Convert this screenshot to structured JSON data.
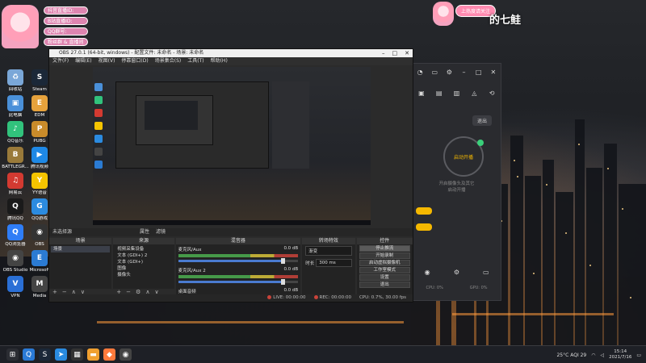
{
  "stickers": {
    "chat_lines": [
      "抖音直播ID:",
      "B站直播ID:",
      "QQ群号:",
      "粉丝群 & 直播间"
    ],
    "badge": "上热度请关注",
    "streamer_name": "的七鲑"
  },
  "desktop": {
    "icons_left": [
      {
        "label": "回收站",
        "color": "#7aa7d8",
        "glyph": "♻"
      },
      {
        "label": "Steam",
        "color": "#1b2838",
        "glyph": "S"
      },
      {
        "label": "此电脑",
        "color": "#4a90d9",
        "glyph": "▣"
      },
      {
        "label": "EDM",
        "color": "#e6a23c",
        "glyph": "E"
      },
      {
        "label": "QQ音乐",
        "color": "#31c27c",
        "glyph": "♪"
      },
      {
        "label": "PUBG",
        "color": "#c98b2a",
        "glyph": "P"
      },
      {
        "label": "BATTLEGR...",
        "color": "#9a7a3a",
        "glyph": "B"
      },
      {
        "label": "腾讯视频",
        "color": "#1e88e5",
        "glyph": "▶"
      },
      {
        "label": "网易云",
        "color": "#d33a31",
        "glyph": "♫"
      },
      {
        "label": "YY语音",
        "color": "#f5c400",
        "glyph": "Y"
      },
      {
        "label": "腾讯QQ",
        "color": "#1a1a1a",
        "glyph": "Q"
      },
      {
        "label": "QQ游戏",
        "color": "#2b8be0",
        "glyph": "G"
      },
      {
        "label": "QQ浏览器",
        "color": "#2f7df6",
        "glyph": "Q"
      },
      {
        "label": "OBS",
        "color": "#333",
        "glyph": "◉"
      },
      {
        "label": "OBS Studio",
        "color": "#444",
        "glyph": "◉"
      },
      {
        "label": "Microsoft",
        "color": "#2b7bd3",
        "glyph": "E"
      },
      {
        "label": "VPN",
        "color": "#2a6fd6",
        "glyph": "V"
      },
      {
        "label": "Media",
        "color": "#444",
        "glyph": "M"
      }
    ]
  },
  "obs": {
    "title": "OBS 27.0.1 (64-bit, windows) - 配置文件: 未命名 - 场景: 未命名",
    "menu": [
      "文件(F)",
      "编辑(E)",
      "视图(V)",
      "停靠窗口(D)",
      "场景集合(S)",
      "工具(T)",
      "帮助(H)"
    ],
    "scene_bar_text": "未选择源",
    "props_label": "属性",
    "filters_label": "滤镜",
    "docks": {
      "scenes": {
        "title": "场景",
        "items": [
          "场景"
        ]
      },
      "sources": {
        "title": "来源",
        "items": [
          "视频采集设备",
          "文本 (GDI+) 2",
          "文本 (GDI+)",
          "图像",
          "摄像头"
        ]
      },
      "mixer": {
        "title": "混音器",
        "rows": [
          {
            "name": "麦克风/Aux",
            "db": "0.0 dB"
          },
          {
            "name": "麦克风/Aux 2",
            "db": "0.0 dB"
          },
          {
            "name": "桌面音频",
            "db": "0.0 dB"
          }
        ]
      },
      "transitions": {
        "title": "转场特效",
        "type": "渐变",
        "duration_label": "时长",
        "duration": "300 ms"
      },
      "controls": {
        "title": "控件",
        "buttons": [
          "停止推流",
          "开始录制",
          "启动虚拟摄像机",
          "工作室模式",
          "设置",
          "退出"
        ]
      }
    },
    "status": {
      "live_label": "LIVE:",
      "live_time": "00:00:00",
      "rec_label": "REC:",
      "rec_time": "00:00:00",
      "cpu": "CPU: 0.7%, 30.00 fps"
    }
  },
  "right_app": {
    "exit_label": "退出",
    "center_label": "启动开播",
    "hint_line1": "开启摄像头及其它",
    "hint_line2": "启动开播",
    "cpu_label": "CPU: 0%",
    "gpu_label": "GPU: 0%"
  },
  "taskbar": {
    "weather": "25°C  AQI 29",
    "time": "15:14",
    "date": "2021/7/16"
  }
}
